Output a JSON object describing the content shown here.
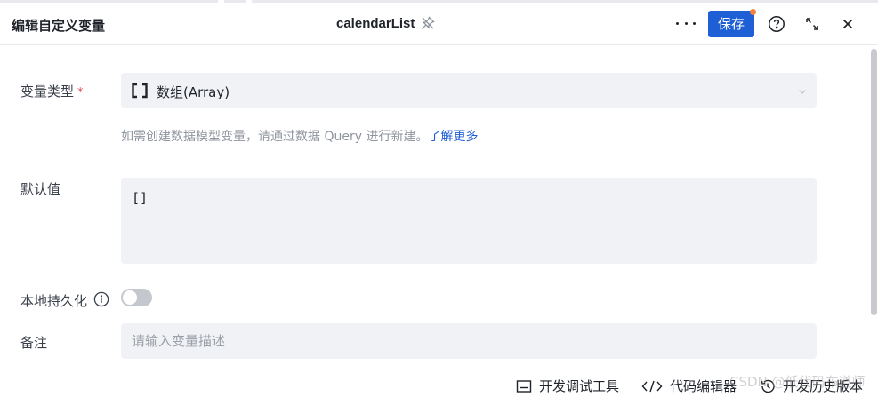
{
  "header": {
    "title": "编辑自定义变量",
    "variable_name": "calendarList",
    "save_label": "保存",
    "icons": [
      "pin-icon",
      "more-icon",
      "help-icon",
      "expand-icon",
      "close-icon"
    ]
  },
  "form": {
    "type_label": "变量类型",
    "required_mark": "*",
    "type_value": "数组(Array)",
    "hint_text": "如需创建数据模型变量，请通过数据 Query 进行新建。",
    "hint_link": "了解更多",
    "default_label": "默认值",
    "default_value": "[]",
    "persist_label": "本地持久化",
    "persist_enabled": false,
    "remark_label": "备注",
    "remark_placeholder": "请输入变量描述"
  },
  "footer": {
    "devtools_label": "开发调试工具",
    "code_editor_label": "代码编辑器",
    "history_label": "开发历史版本"
  },
  "watermark": "CSDN @低代码布道师",
  "colors": {
    "primary": "#1f5fd6",
    "badge": "#f5803a",
    "required": "#e34d59",
    "field_bg": "#f1f2f5"
  }
}
